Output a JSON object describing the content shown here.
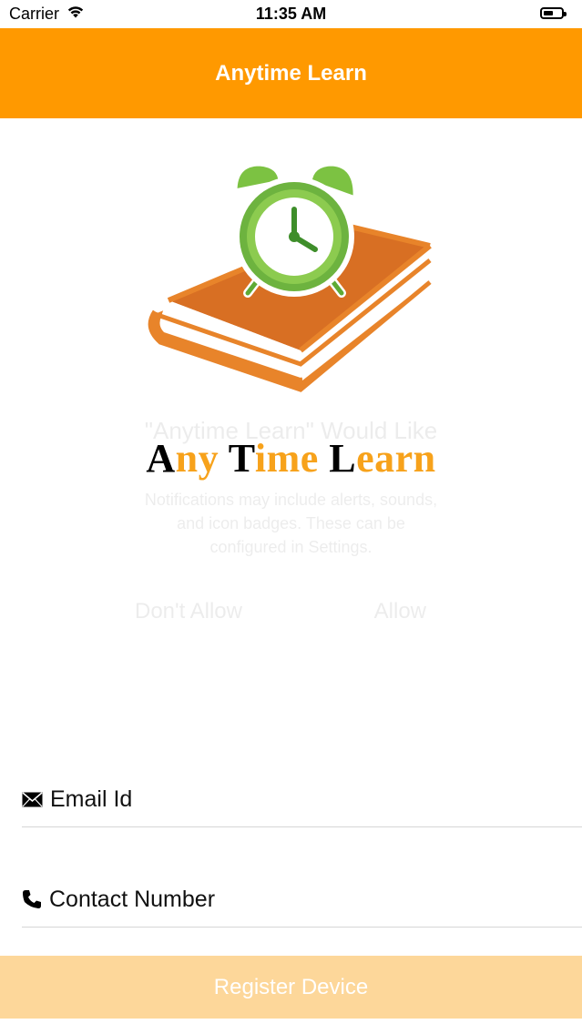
{
  "status_bar": {
    "carrier": "Carrier",
    "time": "11:35 AM",
    "wifi_icon": "wifi-icon",
    "battery_icon": "battery-icon"
  },
  "navbar": {
    "title": "Anytime Learn",
    "background": "#FF9900"
  },
  "logo": {
    "icon": "alarm-clock-book-icon",
    "text_parts": [
      "A",
      "ny ",
      "T",
      "ime ",
      "L",
      "earn"
    ],
    "dark_color": "#000000",
    "accent_color": "#F7A21B"
  },
  "ghost_alert": {
    "title": "\"Anytime Learn\" Would Like",
    "message": "Notifications may include alerts, sounds, and icon badges. These can be configured in Settings.",
    "dont_allow": "Don't Allow",
    "allow": "Allow"
  },
  "form": {
    "email_placeholder": "Email Id",
    "email_icon": "envelope-icon",
    "phone_placeholder": "Contact Number",
    "phone_icon": "phone-icon",
    "register_label": "Register Device",
    "register_color": "#FDD79A"
  }
}
